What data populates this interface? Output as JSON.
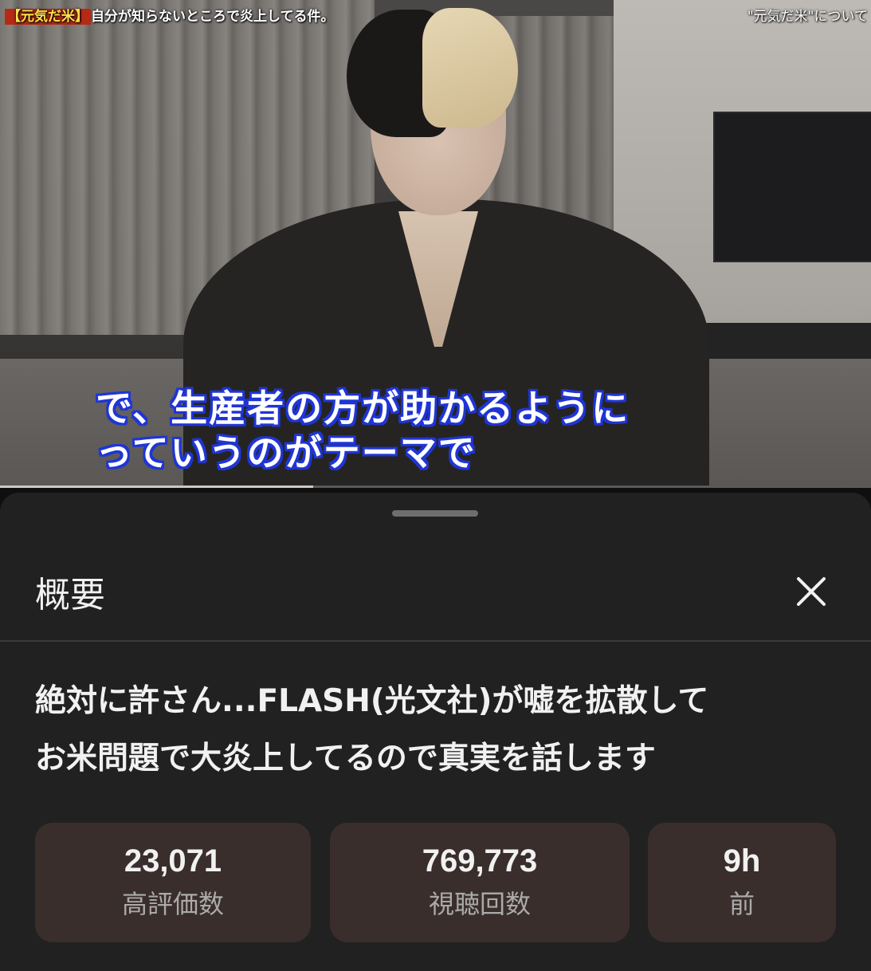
{
  "video": {
    "title_tag": "【元気だ米】",
    "title": "自分が知らないところで炎上してる件。",
    "topic": "\"元気だ米\"について",
    "caption_line1": "で、生産者の方が助かるように",
    "caption_line2": "っていうのがテーマで",
    "progress_percent": 36
  },
  "sheet": {
    "title": "概要",
    "close_icon": "close-icon",
    "description_line1": "絶対に許さん...FLASH(光文社)が嘘を拡散して",
    "description_line2": "お米問題で大炎上してるので真実を話します"
  },
  "stats": [
    {
      "value": "23,071",
      "label": "高評価数"
    },
    {
      "value": "769,773",
      "label": "視聴回数"
    },
    {
      "value": "9h",
      "label": "前"
    }
  ],
  "colors": {
    "background": "#0f0f0f",
    "sheet": "#212121",
    "stat_box": "#3a2e2c",
    "caption_outline": "#1f35d6"
  }
}
